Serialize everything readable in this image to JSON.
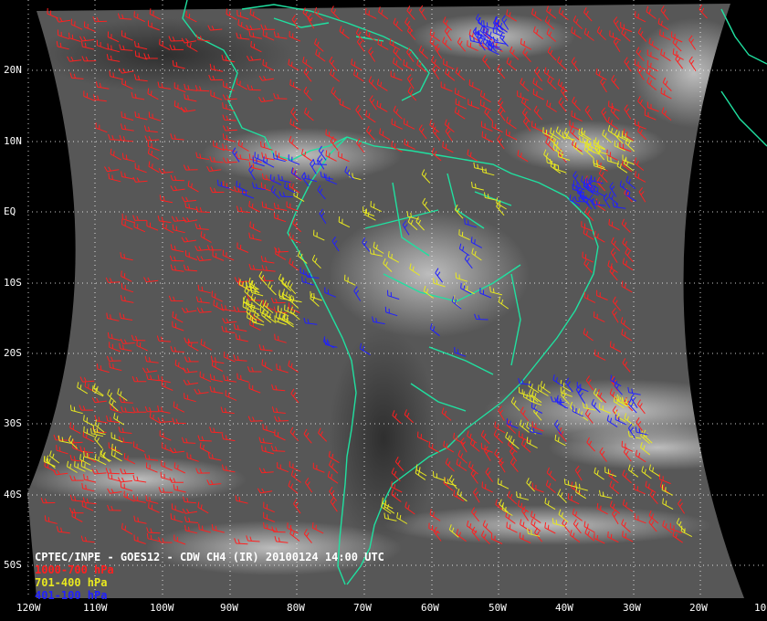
{
  "caption": {
    "title": "CPTEC/INPE - GOES12 - CDW CH4 (IR) 20100124 14:00 UTC"
  },
  "legend": [
    {
      "label": "1000-700 hPa",
      "color": "#ff2020"
    },
    {
      "label": "701-400 hPa",
      "color": "#e8e820"
    },
    {
      "label": "401-100 hPa",
      "color": "#2020ff"
    }
  ],
  "grid": {
    "lat_labels": [
      "20N",
      "10N",
      "EQ",
      "10S",
      "20S",
      "30S",
      "40S",
      "50S"
    ],
    "lon_labels": [
      "120W",
      "110W",
      "100W",
      "90W",
      "80W",
      "70W",
      "60W",
      "50W",
      "40W",
      "30W",
      "20W",
      "10"
    ]
  },
  "colors": {
    "background": "#000000",
    "satellite_gray": "#5a5a5a",
    "coastline": "#20e0a0",
    "grid": "#ffffff"
  }
}
